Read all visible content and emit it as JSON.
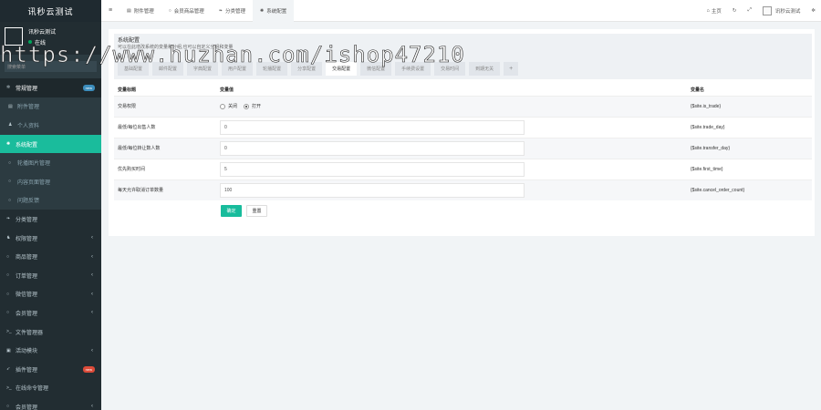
{
  "app": {
    "title": "讯秒云测试"
  },
  "user": {
    "name": "讯秒云测试",
    "status": "在线"
  },
  "search": {
    "placeholder": "搜索菜单"
  },
  "sidebar": {
    "items": [
      {
        "label": "常规管理",
        "badge": "new"
      },
      {
        "label": "附件管理"
      },
      {
        "label": "个人资料"
      },
      {
        "label": "系统配置"
      },
      {
        "label": "轮播图片管理"
      },
      {
        "label": "内容页面管理"
      },
      {
        "label": "问题反馈"
      },
      {
        "label": "分类管理"
      },
      {
        "label": "权限管理"
      },
      {
        "label": "商品管理"
      },
      {
        "label": "订单管理"
      },
      {
        "label": "微信管理"
      },
      {
        "label": "会员管理"
      },
      {
        "label": "文件管理器"
      },
      {
        "label": "活动模块"
      },
      {
        "label": "插件管理",
        "badge": "new"
      },
      {
        "label": "在线命令管理"
      },
      {
        "label": "会员管理"
      }
    ]
  },
  "topbar": {
    "tabs": [
      "附件管理",
      "会员商品管理",
      "分类管理",
      "系统配置"
    ],
    "home": "主页",
    "username": "讯秒云测试"
  },
  "panel": {
    "title": "系统配置",
    "subtitle": "可以在此增改系统的变量和分组,也可以自定义分组和变量",
    "tabs": [
      "基础配置",
      "邮件配置",
      "字典配置",
      "用户配置",
      "轮播配置",
      "分享配置",
      "交易配置",
      "微信配置",
      "手续费设置",
      "交易时间",
      "到期无关"
    ],
    "active_tab": "交易配置"
  },
  "table": {
    "headers": [
      "变量标题",
      "变量值",
      "变量名"
    ],
    "rows": [
      {
        "title": "交易权限",
        "type": "radio",
        "options": [
          "关闭",
          "打开"
        ],
        "selected": "打开",
        "name": "{$site.is_trade}"
      },
      {
        "title": "最低/每位出售人数",
        "type": "input",
        "value": "0",
        "name": "{$site.trade_day}"
      },
      {
        "title": "最低/每位转让数人数",
        "type": "input",
        "value": "0",
        "name": "{$site.transfer_day}"
      },
      {
        "title": "优先购买时间",
        "type": "input",
        "value": "5",
        "name": "{$site.first_time}"
      },
      {
        "title": "每天允许取消订单数量",
        "type": "input",
        "value": "100",
        "name": "{$site.cancel_order_count}"
      }
    ]
  },
  "buttons": {
    "ok": "确定",
    "reset": "重置"
  },
  "watermark": "https://www.huzhan.com/ishop47210",
  "colors": {
    "sidebar_bg": "#222d32",
    "active": "#18bc9c",
    "badge_blue": "#3c8dbc",
    "badge_red": "#dd4b39"
  }
}
